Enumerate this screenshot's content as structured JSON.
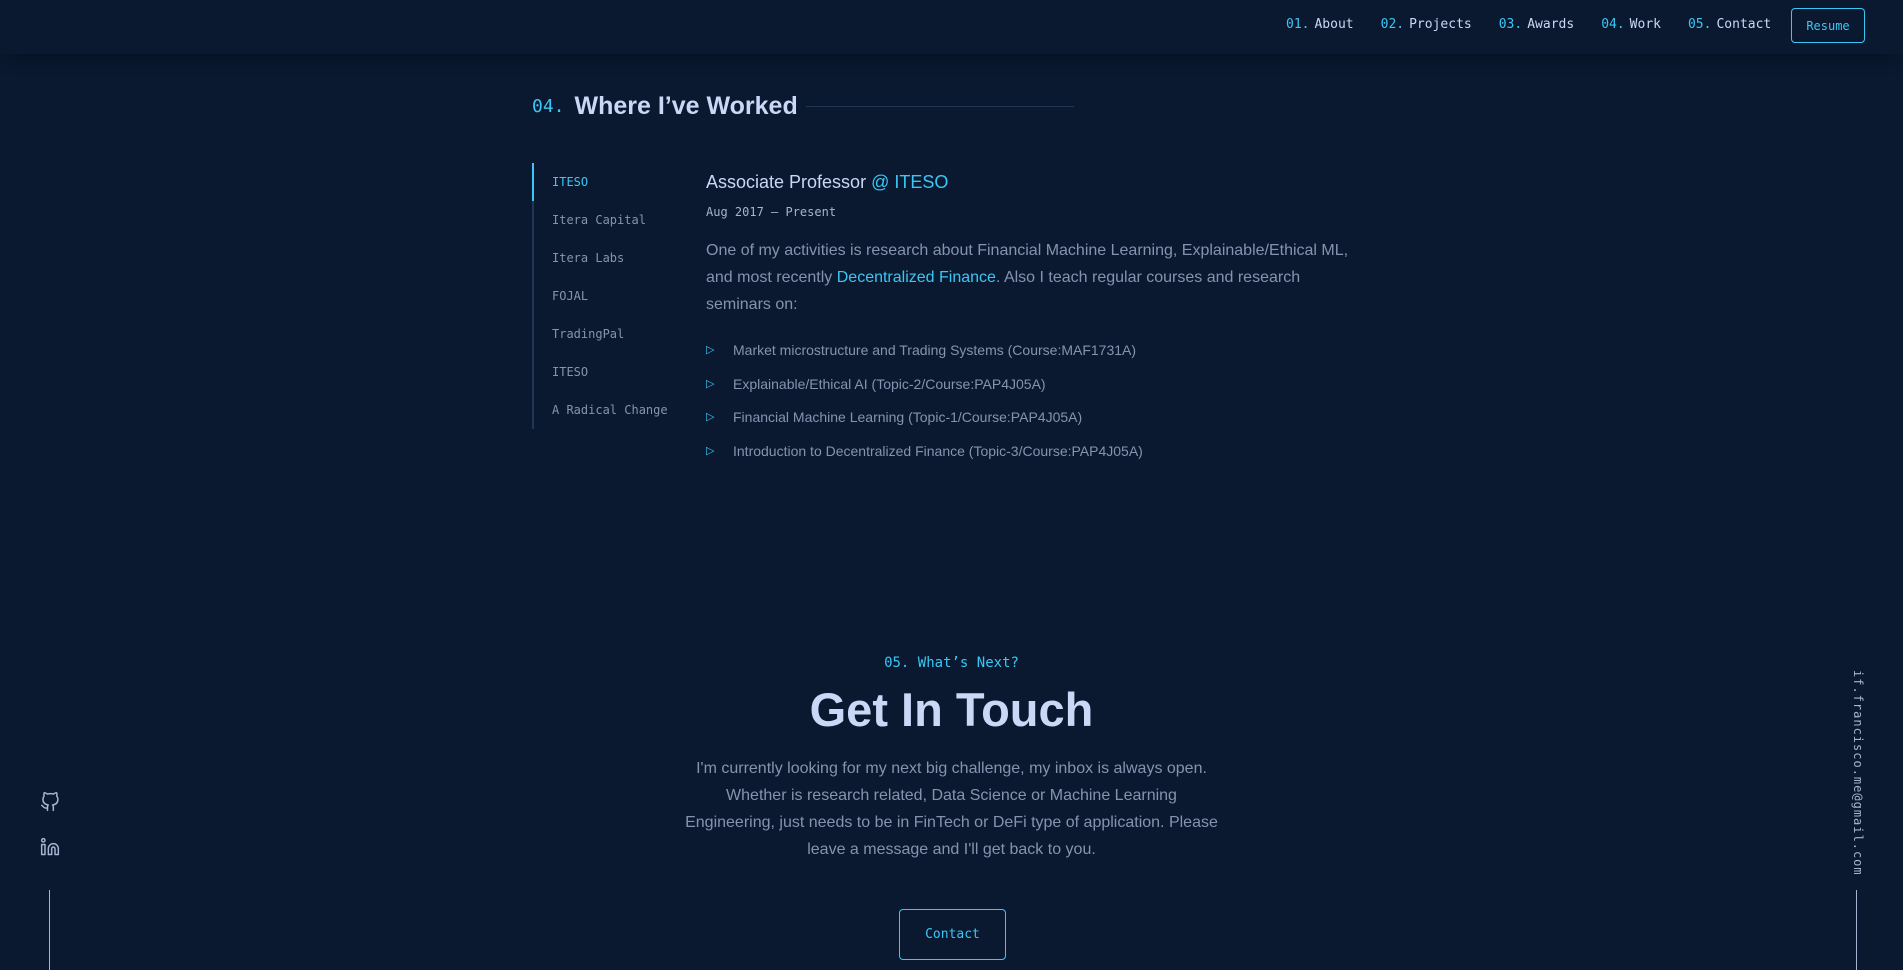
{
  "nav": {
    "items": [
      {
        "num": "01.",
        "label": "About"
      },
      {
        "num": "02.",
        "label": "Projects"
      },
      {
        "num": "03.",
        "label": "Awards"
      },
      {
        "num": "04.",
        "label": "Work"
      },
      {
        "num": "05.",
        "label": "Contact"
      }
    ],
    "resume_label": "Resume"
  },
  "work": {
    "num": "04.",
    "heading": "Where I’ve Worked",
    "tabs": [
      "ITESO",
      "Itera Capital",
      "Itera Labs",
      "FOJAL",
      "TradingPal",
      "ITESO",
      "A Radical Change"
    ],
    "active_tab": 0,
    "job": {
      "title": "Associate Professor",
      "company": "@ ITESO",
      "range": "Aug 2017 — Present",
      "desc_before": "One of my activities is research about Financial Machine Learning, Explainable/Ethical ML, and most recently ",
      "desc_link": "Decentralized Finance",
      "desc_after": ". Also I teach regular courses and research seminars on:",
      "bullets": [
        "Market microstructure and Trading Systems (Course:MAF1731A)",
        "Explainable/Ethical AI (Topic-2/Course:PAP4J05A)",
        "Financial Machine Learning (Topic-1/Course:PAP4J05A)",
        "Introduction to Decentralized Finance (Topic-3/Course:PAP4J05A)"
      ]
    }
  },
  "contact": {
    "overline": "05. What’s Next?",
    "title": "Get In Touch",
    "text": "I'm currently looking for my next big challenge, my inbox is always open. Whether is research related, Data Science or Machine Learning Engineering, just needs to be in FinTech or DeFi type of application. Please leave a message and I'll get back to you.",
    "button_label": "Contact"
  },
  "side": {
    "email": "if.francisco.me@gmail.com",
    "icons": [
      "github-icon",
      "linkedin-icon"
    ]
  },
  "colors": {
    "background": "#0a192f",
    "accent": "#3ac7f5",
    "heading": "#ccd6f6",
    "text": "#8892b0"
  }
}
